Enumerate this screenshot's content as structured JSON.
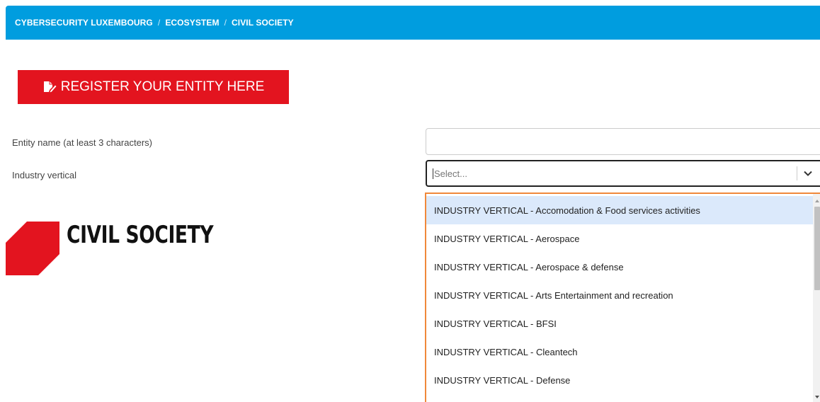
{
  "breadcrumb": {
    "items": [
      "CYBERSECURITY LUXEMBOURG",
      "ECOSYSTEM",
      "CIVIL SOCIETY"
    ],
    "separator": "/"
  },
  "register_button": {
    "label": "REGISTER YOUR ENTITY HERE",
    "icon": "edit-document-icon"
  },
  "form": {
    "entity_name_label": "Entity name (at least 3 characters)",
    "entity_name_value": "",
    "industry_vertical_label": "Industry vertical",
    "industry_vertical_placeholder": "Select..."
  },
  "dropdown": {
    "options": [
      "INDUSTRY VERTICAL - Accomodation & Food services activities",
      "INDUSTRY VERTICAL - Aerospace",
      "INDUSTRY VERTICAL - Aerospace & defense",
      "INDUSTRY VERTICAL - Arts Entertainment and recreation",
      "INDUSTRY VERTICAL - BFSI",
      "INDUSTRY VERTICAL - Cleantech",
      "INDUSTRY VERTICAL - Defense"
    ],
    "focused_index": 0
  },
  "logo": {
    "title": "CIVIL SOCIETY"
  },
  "colors": {
    "breadcrumb_bg": "#009ddf",
    "accent_red": "#e3141f",
    "menu_border": "#f0883a",
    "option_focus": "#dbe9fb"
  }
}
